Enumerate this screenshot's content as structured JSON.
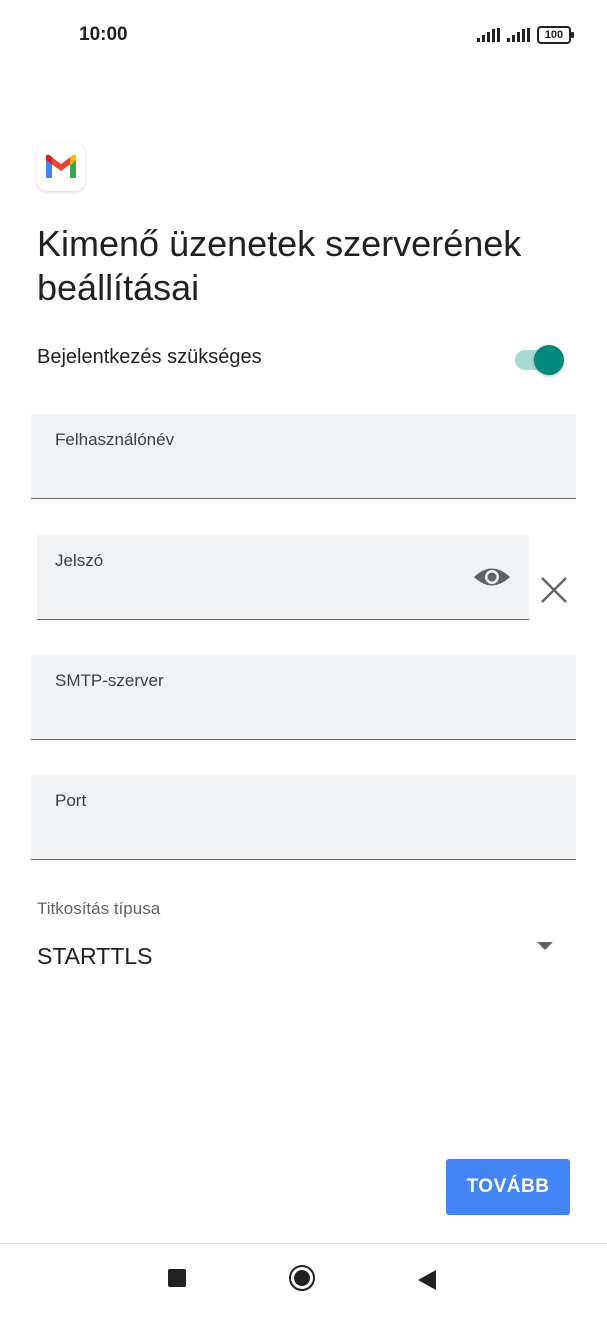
{
  "status_bar": {
    "time": "10:00",
    "battery": "100"
  },
  "page": {
    "title": "Kimenő üzenetek szerverének beállításai",
    "login_required": {
      "label": "Bejelentkezés szükséges",
      "checked": true
    }
  },
  "fields": {
    "username": {
      "label": "Felhasználónév"
    },
    "password": {
      "label": "Jelszó"
    },
    "smtp": {
      "label": "SMTP-szerver"
    },
    "port": {
      "label": "Port"
    }
  },
  "encryption": {
    "label": "Titkosítás típusa",
    "value": "STARTTLS"
  },
  "actions": {
    "next_label": "TOVÁBB"
  },
  "colors": {
    "accent": "#00897b",
    "button": "#4285f4"
  },
  "icons": [
    "signal-icon",
    "battery-icon",
    "gmail-logo-icon",
    "eye-icon",
    "close-icon",
    "dropdown-caret-icon",
    "nav-recent-icon",
    "nav-home-icon",
    "nav-back-icon"
  ]
}
